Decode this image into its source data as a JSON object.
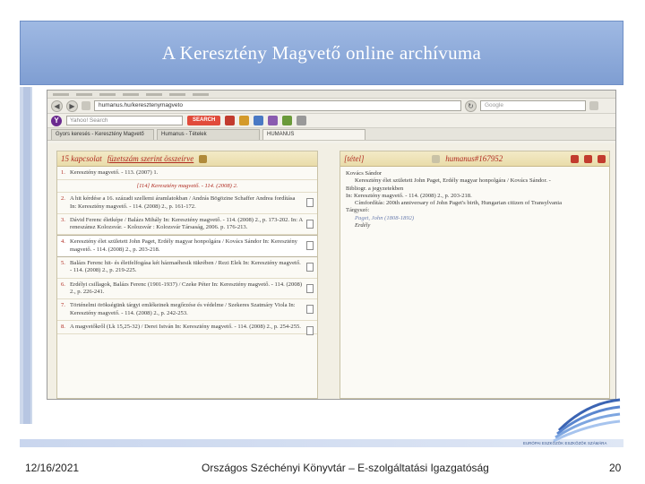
{
  "slide": {
    "title": "A Keresztény Magvető online archívuma",
    "footer_date": "12/16/2021",
    "footer_org": "Országos Széchényi Könyvtár – E-szolgáltatási Igazgatóság",
    "page_number": "20",
    "logo_text": "EURÓPAI ESZKÖZÖK ESZKÖZÖK SZÁMÁRA"
  },
  "browser": {
    "url": "humanus.hu/keresztenymagveto",
    "search_placeholder": "Google",
    "yahoo_placeholder": "Yahoo! Search",
    "yahoo_button": "SEARCH",
    "tabs": [
      {
        "label": "Gyors keresés - Keresztény Magvető"
      },
      {
        "label": "Humanus - Tételek"
      },
      {
        "label": "HUMANUS"
      }
    ]
  },
  "left_pane": {
    "title_count": "15 kapcsolat",
    "title_sort": "füzetszám szerint összeírve",
    "subheading": "[114] Keresztény magvető. - 114. (2008) 2.",
    "records": [
      {
        "num": "1.",
        "text": "Keresztény magvető. - 113. (2007) 1."
      },
      {
        "num": "2.",
        "text": "A hit kérdése a 16. századi szellemi áramlatokban / András Bögözine Schaffer Andrea fordítása In: Keresztény magvető. - 114. (2008) 2., p. 161-172."
      },
      {
        "num": "3.",
        "text": "Dávid Ferenc életképe / Balázs Mihály In: Keresztény magvető. - 114. (2008) 2., p. 173-202. In: A reneszánsz Kolozsvár. - Kolozsvár : Kolozsvár Társaság, 2006. p. 176-213."
      },
      {
        "num": "4.",
        "text": "Keresztény élet született John Paget, Erdély magyar honpolgára / Kovács Sándor In: Keresztény magvető. - 114. (2008) 2., p. 203-218."
      },
      {
        "num": "5.",
        "text": "Balázs Ferenc hit- és életfelfogása két házmaéhesik tükrében / Rezi Elek In: Keresztény magvető. - 114. (2008) 2., p. 219-225."
      },
      {
        "num": "6.",
        "text": "Erdélyi csillagok, Balázs Ferenc (1901-1937) / Czeke Péter In: Keresztény magvető. - 114. (2008) 2., p. 226-241."
      },
      {
        "num": "7.",
        "text": "Történelmi örökségünk tárgyi emlékeinek megőrzése és védelme / Szekeres Szatmáry Viola In: Keresztény magvető. - 114. (2008) 2., p. 242-253."
      },
      {
        "num": "8.",
        "text": "A magvetőkről (Lk 15,25-32) / Derei István In: Keresztény magvető. - 114. (2008) 2., p. 254-255."
      }
    ]
  },
  "right_pane": {
    "title_item": "[tétel]",
    "title_id": "humanus#167952",
    "author": "Kovács Sándor",
    "lines": [
      "Keresztény élet született John Paget, Erdély magyar honpolgára / Kovács Sándor. -",
      "Bibliogr. a jegyzetekben",
      "In: Keresztény magvető. - 114. (2008) 2., p. 203-218.",
      "Címfordítás: 200th anniversary of John Paget's birth, Hungarian citizen of Transylvania",
      "Tárgyszó:",
      "Paget, John (1808-1892)",
      "Erdély"
    ]
  },
  "colors": {
    "title_bar": "#8aa8da",
    "pane_title": "#b02a20",
    "pane_head": "#efe4bb"
  }
}
